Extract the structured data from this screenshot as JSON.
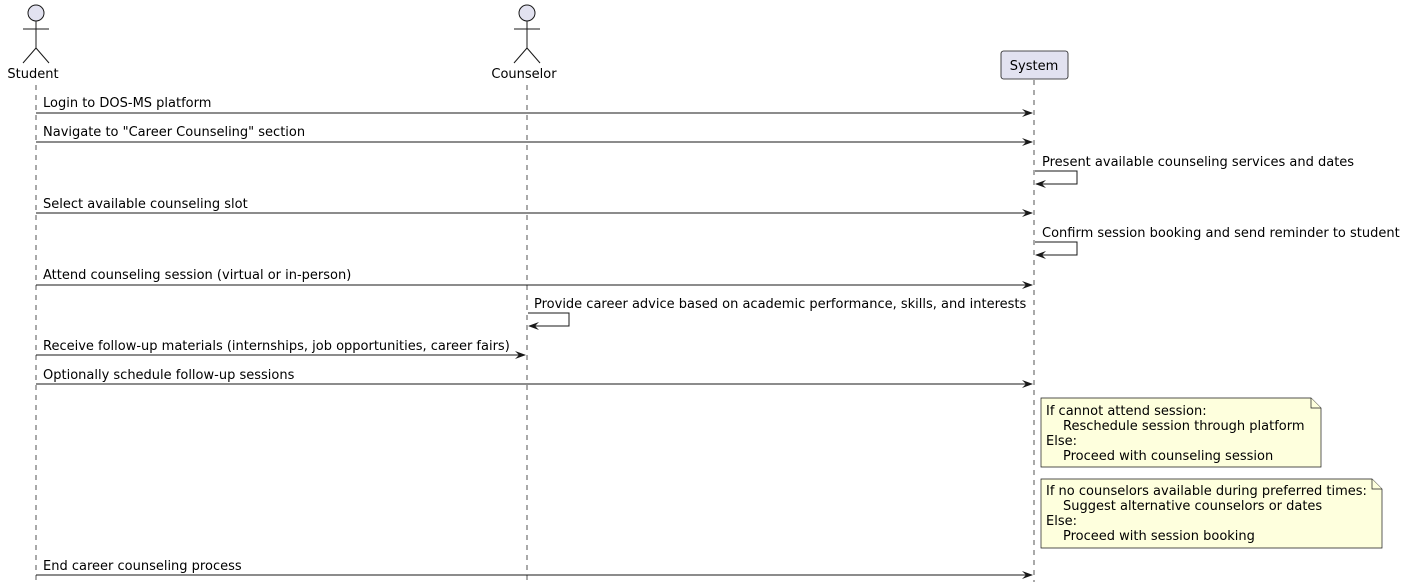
{
  "participants": {
    "student": {
      "label": "Student",
      "kind": "actor"
    },
    "counselor": {
      "label": "Counselor",
      "kind": "actor"
    },
    "system": {
      "label": "System",
      "kind": "participant"
    }
  },
  "colors": {
    "participant_fill": "#E2E2F0",
    "note_fill": "#FEFFDD",
    "line": "#181818"
  },
  "messages": [
    {
      "text": "Login to DOS-MS platform",
      "from": "student",
      "to": "system"
    },
    {
      "text": "Navigate to \"Career Counseling\" section",
      "from": "student",
      "to": "system"
    },
    {
      "text": "Present available counseling services and dates",
      "from": "system",
      "to": "system"
    },
    {
      "text": "Select available counseling slot",
      "from": "student",
      "to": "system"
    },
    {
      "text": "Confirm session booking and send reminder to student",
      "from": "system",
      "to": "system"
    },
    {
      "text": "Attend counseling session (virtual or in-person)",
      "from": "student",
      "to": "system"
    },
    {
      "text": "Provide career advice based on academic performance, skills, and interests",
      "from": "counselor",
      "to": "counselor"
    },
    {
      "text": "Receive follow-up materials (internships, job opportunities, career fairs)",
      "from": "student",
      "to": "counselor"
    },
    {
      "text": "Optionally schedule follow-up sessions",
      "from": "student",
      "to": "system"
    },
    {
      "text": "End career counseling process",
      "from": "student",
      "to": "system"
    }
  ],
  "notes": [
    {
      "over": "system",
      "lines": [
        "If cannot attend session:",
        "Reschedule session through platform",
        "Else:",
        "Proceed with counseling session"
      ]
    },
    {
      "over": "system",
      "lines": [
        "If no counselors available during preferred times:",
        "Suggest alternative counselors or dates",
        "Else:",
        "Proceed with session booking"
      ]
    }
  ]
}
